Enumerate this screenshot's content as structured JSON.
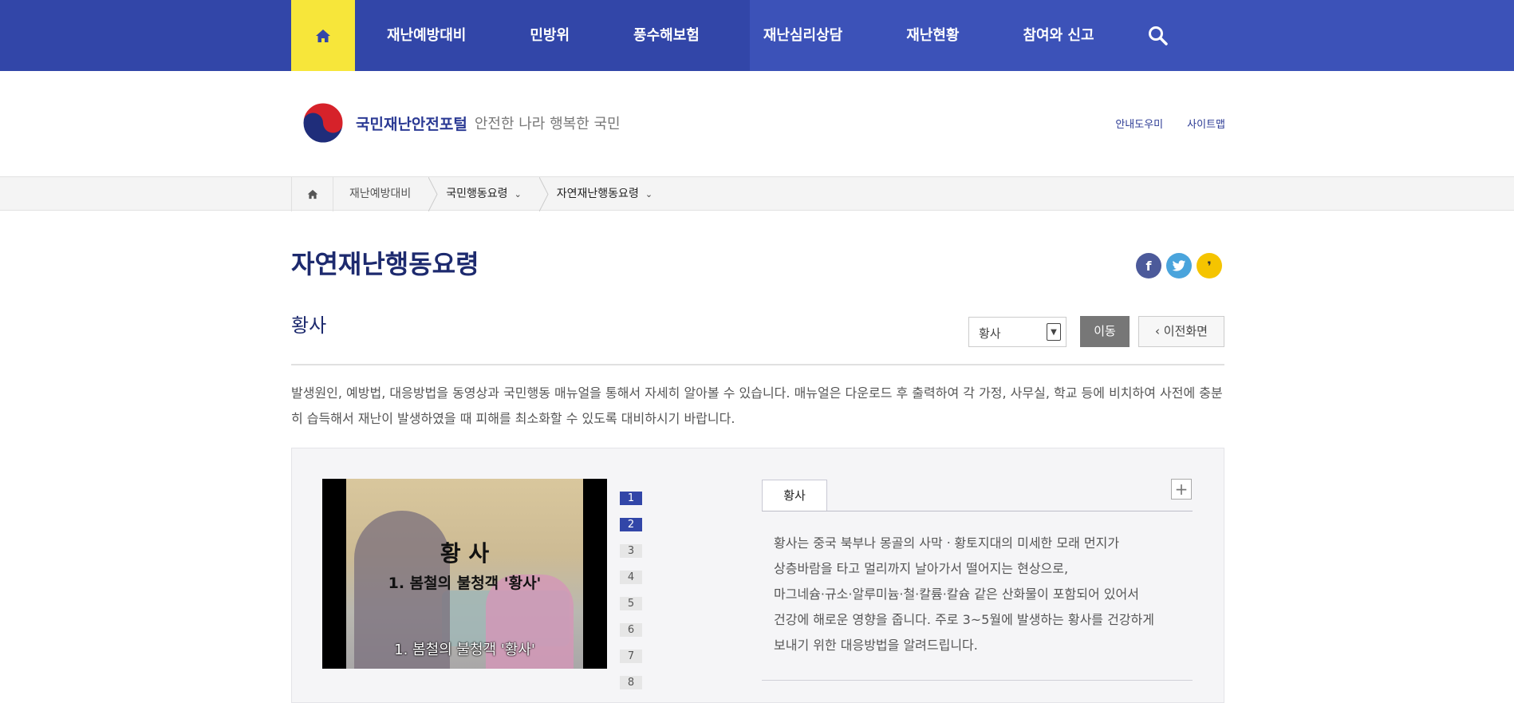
{
  "nav": {
    "items": [
      "재난예방대비",
      "민방위",
      "풍수해보험",
      "재난심리상담",
      "재난현황",
      "참여와 신고"
    ],
    "home_icon": "home-icon",
    "search_icon": "search-icon"
  },
  "header": {
    "logo_title": "국민재난안전포털",
    "logo_subtitle": "안전한 나라 행복한 국민",
    "util_links": [
      "안내도우미",
      "사이트맵"
    ]
  },
  "breadcrumb": {
    "items": [
      "재난예방대비",
      "국민행동요령",
      "자연재난행동요령"
    ]
  },
  "page": {
    "title": "자연재난행동요령",
    "subtitle": "황사",
    "select_value": "황사",
    "go_label": "이동",
    "prev_label": "이전화면",
    "description": "발생원인, 예방법, 대응방법을 동영상과 국민행동 매뉴얼을 통해서 자세히 알아볼 수 있습니다. 매뉴얼은 다운로드 후 출력하여 각 가정, 사무실, 학교 등에 비치하여 사전에 충분히 습득해서 재난이 발생하였을 때 피해를 최소화할 수 있도록 대비하시기 바랍니다."
  },
  "social": [
    "facebook-icon",
    "twitter-icon",
    "kakaostory-icon"
  ],
  "video": {
    "title": "황 사",
    "subtitle": "1. 봄철의 불청객 '황사'",
    "caption": "1. 봄철의 불청객 '황사'",
    "chapters": [
      "1",
      "2",
      "3",
      "4",
      "5",
      "6",
      "7",
      "8"
    ],
    "active_chapters": [
      0,
      1
    ]
  },
  "info": {
    "tab_label": "황사",
    "text": [
      "황사는 중국 북부나 몽골의 사막ㆍ황토지대의 미세한 모래 먼지가",
      "상층바람을 타고 멀리까지 날아가서 떨어지는 현상으로,",
      "마그네슘·규소·알루미늄·철·칼륨·칼슘 같은 산화물이 포함되어 있어서",
      "건강에 해로운 영향을 줍니다. 주로 3~5월에 발생하는 황사를 건강하게",
      "보내기 위한 대응방법을 알려드립니다."
    ]
  }
}
